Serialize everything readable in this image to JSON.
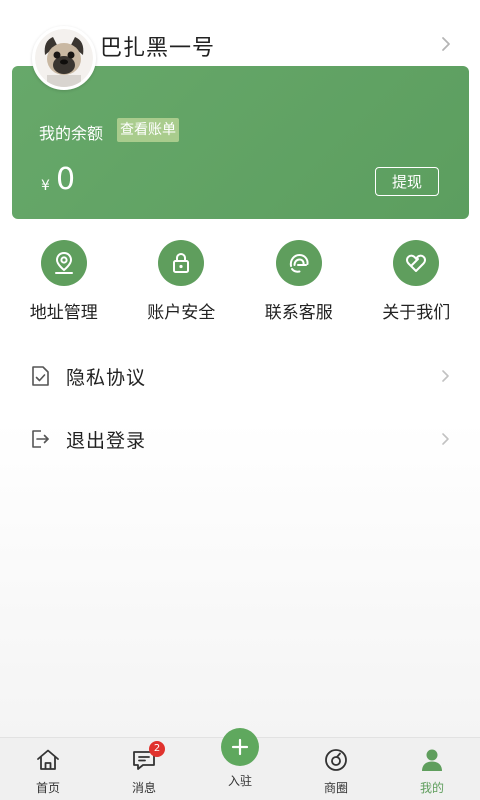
{
  "profile": {
    "username": "巴扎黑一号"
  },
  "balance": {
    "label": "我的余额",
    "view_bill_label": "查看账单",
    "currency": "¥",
    "amount": "0",
    "withdraw_label": "提现"
  },
  "quick_actions": [
    {
      "label": "地址管理",
      "icon": "location-icon"
    },
    {
      "label": "账户安全",
      "icon": "lock-icon"
    },
    {
      "label": "联系客服",
      "icon": "customer-service-icon"
    },
    {
      "label": "关于我们",
      "icon": "heart-icon"
    }
  ],
  "menu": [
    {
      "label": "隐私协议",
      "icon": "document-check-icon"
    },
    {
      "label": "退出登录",
      "icon": "logout-icon"
    }
  ],
  "bottom_nav": {
    "items": [
      {
        "label": "首页",
        "icon": "home-icon"
      },
      {
        "label": "消息",
        "icon": "message-icon",
        "badge": "2"
      },
      {
        "label": "入驻",
        "icon": "plus-icon"
      },
      {
        "label": "商圈",
        "icon": "compass-icon"
      },
      {
        "label": "我的",
        "icon": "user-icon",
        "active": true
      }
    ]
  },
  "colors": {
    "accent": "#5f9e5d",
    "badge": "#e0322d"
  }
}
